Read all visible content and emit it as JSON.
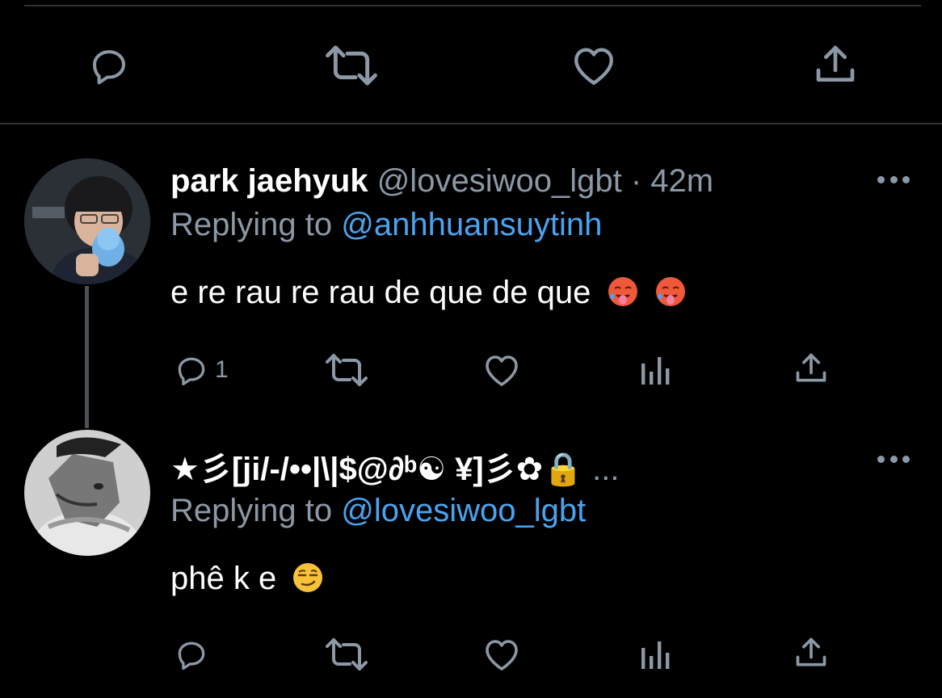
{
  "top_actions": {
    "reply_icon": "reply-icon",
    "retweet_icon": "retweet-icon",
    "like_icon": "like-icon",
    "share_icon": "share-icon"
  },
  "tweets": [
    {
      "name": "park jaehyuk",
      "handle": "@lovesiwoo_lgbt",
      "separator": "·",
      "time": "42m",
      "replying_prefix": "Replying to",
      "replying_to": "@anhhuansuytinh",
      "text": "e re rau re rau de que de que",
      "emoji": [
        "hot-face-emoji",
        "hot-face-emoji"
      ],
      "reply_count": "1"
    },
    {
      "name": "★彡[ji/-/••|\\|$@∂ᵇ☯ ¥]彡✿🔒",
      "name_overflow": "...",
      "replying_prefix": "Replying to",
      "replying_to": "@lovesiwoo_lgbt",
      "text": "phê k e",
      "emoji": [
        "smirk-emoji"
      ],
      "reply_count": ""
    }
  ],
  "colors": {
    "background": "#000000",
    "muted": "#8b98a5",
    "link": "#4ba3f0",
    "divider": "#2f3336"
  }
}
